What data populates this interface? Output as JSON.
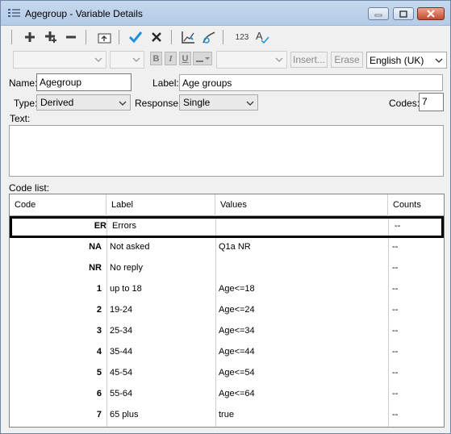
{
  "window": {
    "title": "Agegroup - Variable Details"
  },
  "toolbar": {
    "icons": [
      "add-icon",
      "add-multiple-icon",
      "remove-icon",
      "move-up-icon",
      "check-icon",
      "delete-icon",
      "chart-edit-icon",
      "chart-link-icon",
      "number-format-icon",
      "spell-check-icon"
    ],
    "number_label": "123",
    "spell_label": "A"
  },
  "format_bar": {
    "bold": "B",
    "italic": "I",
    "underline": "U",
    "insert_button": "Insert...",
    "erase_button": "Erase",
    "language": "English (UK)"
  },
  "form": {
    "name_label": "Name:",
    "name_value": "Agegroup",
    "label_label": "Label:",
    "label_value": "Age groups",
    "type_label": "Type:",
    "type_value": "Derived",
    "response_label": "Response:",
    "response_value": "Single",
    "codes_label": "Codes:",
    "codes_value": "7",
    "text_label": "Text:"
  },
  "code_list": {
    "title": "Code list:",
    "columns": [
      "Code",
      "Label",
      "Values",
      "Counts"
    ],
    "rows": [
      {
        "code": "ER",
        "label": "Errors",
        "values": "",
        "counts": "--"
      },
      {
        "code": "NA",
        "label": "Not asked",
        "values": "Q1a NR",
        "counts": "--"
      },
      {
        "code": "NR",
        "label": "No reply",
        "values": "",
        "counts": "--"
      },
      {
        "code": "1",
        "label": "up to 18",
        "values": "Age<=18",
        "counts": "--"
      },
      {
        "code": "2",
        "label": "19-24",
        "values": "Age<=24",
        "counts": "--"
      },
      {
        "code": "3",
        "label": "25-34",
        "values": "Age<=34",
        "counts": "--"
      },
      {
        "code": "4",
        "label": "35-44",
        "values": "Age<=44",
        "counts": "--"
      },
      {
        "code": "5",
        "label": "45-54",
        "values": "Age<=54",
        "counts": "--"
      },
      {
        "code": "6",
        "label": "55-64",
        "values": "Age<=64",
        "counts": "--"
      },
      {
        "code": "7",
        "label": "65 plus",
        "values": "true",
        "counts": "--"
      }
    ],
    "selected_index": 0
  },
  "colors": {
    "accent_check": "#1e90d8",
    "delete_x": "#2a2a2a"
  }
}
